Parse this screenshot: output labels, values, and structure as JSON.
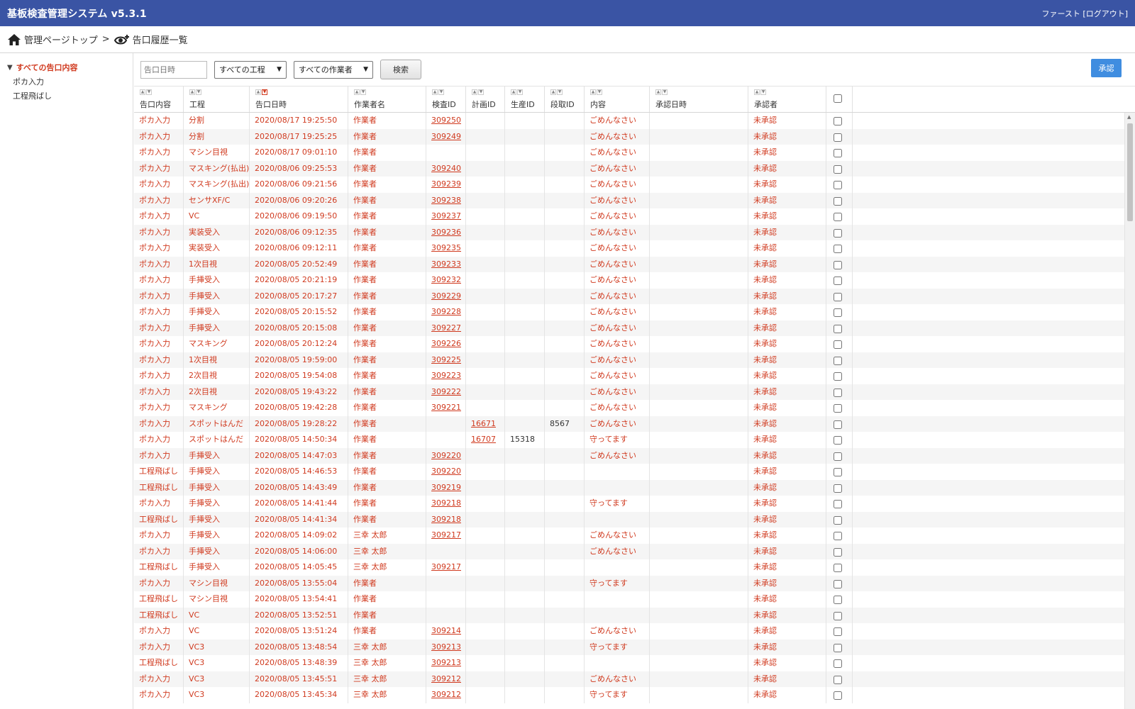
{
  "header": {
    "title": "基板検査管理システム v5.3.1",
    "user_name": "ファースト",
    "logout_label": "[ログアウト]"
  },
  "breadcrumb": {
    "home_label": "管理ページトップ",
    "separator": ">",
    "current_label": "告口履歴一覧"
  },
  "sidebar": {
    "root_label": "すべての告口内容",
    "items": [
      {
        "label": "ポカ入力"
      },
      {
        "label": "工程飛ばし"
      }
    ]
  },
  "toolbar": {
    "date_placeholder": "告口日時",
    "process_select": "すべての工程",
    "worker_select": "すべての作業者",
    "search_label": "検索",
    "approve_label": "承認"
  },
  "table": {
    "columns": [
      "告口内容",
      "工程",
      "告口日時",
      "作業者名",
      "検査ID",
      "計画ID",
      "生産ID",
      "段取ID",
      "内容",
      "承認日時",
      "承認者"
    ],
    "rows": [
      [
        "ポカ入力",
        "分割",
        "2020/08/17 19:25:50",
        "作業者",
        "309250",
        "",
        "",
        "",
        "ごめんなさい",
        "",
        "未承認"
      ],
      [
        "ポカ入力",
        "分割",
        "2020/08/17 19:25:25",
        "作業者",
        "309249",
        "",
        "",
        "",
        "ごめんなさい",
        "",
        "未承認"
      ],
      [
        "ポカ入力",
        "マシン目視",
        "2020/08/17 09:01:10",
        "作業者",
        "",
        "",
        "",
        "",
        "ごめんなさい",
        "",
        "未承認"
      ],
      [
        "ポカ入力",
        "マスキング(払出)",
        "2020/08/06 09:25:53",
        "作業者",
        "309240",
        "",
        "",
        "",
        "ごめんなさい",
        "",
        "未承認"
      ],
      [
        "ポカ入力",
        "マスキング(払出)",
        "2020/08/06 09:21:56",
        "作業者",
        "309239",
        "",
        "",
        "",
        "ごめんなさい",
        "",
        "未承認"
      ],
      [
        "ポカ入力",
        "センサXF/C",
        "2020/08/06 09:20:26",
        "作業者",
        "309238",
        "",
        "",
        "",
        "ごめんなさい",
        "",
        "未承認"
      ],
      [
        "ポカ入力",
        "VC",
        "2020/08/06 09:19:50",
        "作業者",
        "309237",
        "",
        "",
        "",
        "ごめんなさい",
        "",
        "未承認"
      ],
      [
        "ポカ入力",
        "実装受入",
        "2020/08/06 09:12:35",
        "作業者",
        "309236",
        "",
        "",
        "",
        "ごめんなさい",
        "",
        "未承認"
      ],
      [
        "ポカ入力",
        "実装受入",
        "2020/08/06 09:12:11",
        "作業者",
        "309235",
        "",
        "",
        "",
        "ごめんなさい",
        "",
        "未承認"
      ],
      [
        "ポカ入力",
        "1次目視",
        "2020/08/05 20:52:49",
        "作業者",
        "309233",
        "",
        "",
        "",
        "ごめんなさい",
        "",
        "未承認"
      ],
      [
        "ポカ入力",
        "手挿受入",
        "2020/08/05 20:21:19",
        "作業者",
        "309232",
        "",
        "",
        "",
        "ごめんなさい",
        "",
        "未承認"
      ],
      [
        "ポカ入力",
        "手挿受入",
        "2020/08/05 20:17:27",
        "作業者",
        "309229",
        "",
        "",
        "",
        "ごめんなさい",
        "",
        "未承認"
      ],
      [
        "ポカ入力",
        "手挿受入",
        "2020/08/05 20:15:52",
        "作業者",
        "309228",
        "",
        "",
        "",
        "ごめんなさい",
        "",
        "未承認"
      ],
      [
        "ポカ入力",
        "手挿受入",
        "2020/08/05 20:15:08",
        "作業者",
        "309227",
        "",
        "",
        "",
        "ごめんなさい",
        "",
        "未承認"
      ],
      [
        "ポカ入力",
        "マスキング",
        "2020/08/05 20:12:24",
        "作業者",
        "309226",
        "",
        "",
        "",
        "ごめんなさい",
        "",
        "未承認"
      ],
      [
        "ポカ入力",
        "1次目視",
        "2020/08/05 19:59:00",
        "作業者",
        "309225",
        "",
        "",
        "",
        "ごめんなさい",
        "",
        "未承認"
      ],
      [
        "ポカ入力",
        "2次目視",
        "2020/08/05 19:54:08",
        "作業者",
        "309223",
        "",
        "",
        "",
        "ごめんなさい",
        "",
        "未承認"
      ],
      [
        "ポカ入力",
        "2次目視",
        "2020/08/05 19:43:22",
        "作業者",
        "309222",
        "",
        "",
        "",
        "ごめんなさい",
        "",
        "未承認"
      ],
      [
        "ポカ入力",
        "マスキング",
        "2020/08/05 19:42:28",
        "作業者",
        "309221",
        "",
        "",
        "",
        "ごめんなさい",
        "",
        "未承認"
      ],
      [
        "ポカ入力",
        "スポットはんだ",
        "2020/08/05 19:28:22",
        "作業者",
        "",
        "16671",
        "",
        "8567",
        "ごめんなさい",
        "",
        "未承認"
      ],
      [
        "ポカ入力",
        "スポットはんだ",
        "2020/08/05 14:50:34",
        "作業者",
        "",
        "16707",
        "15318",
        "",
        "守ってます",
        "",
        "未承認"
      ],
      [
        "ポカ入力",
        "手挿受入",
        "2020/08/05 14:47:03",
        "作業者",
        "309220",
        "",
        "",
        "",
        "ごめんなさい",
        "",
        "未承認"
      ],
      [
        "工程飛ばし",
        "手挿受入",
        "2020/08/05 14:46:53",
        "作業者",
        "309220",
        "",
        "",
        "",
        "",
        "",
        "未承認"
      ],
      [
        "工程飛ばし",
        "手挿受入",
        "2020/08/05 14:43:49",
        "作業者",
        "309219",
        "",
        "",
        "",
        "",
        "",
        "未承認"
      ],
      [
        "ポカ入力",
        "手挿受入",
        "2020/08/05 14:41:44",
        "作業者",
        "309218",
        "",
        "",
        "",
        "守ってます",
        "",
        "未承認"
      ],
      [
        "工程飛ばし",
        "手挿受入",
        "2020/08/05 14:41:34",
        "作業者",
        "309218",
        "",
        "",
        "",
        "",
        "",
        "未承認"
      ],
      [
        "ポカ入力",
        "手挿受入",
        "2020/08/05 14:09:02",
        "三幸 太郎",
        "309217",
        "",
        "",
        "",
        "ごめんなさい",
        "",
        "未承認"
      ],
      [
        "ポカ入力",
        "手挿受入",
        "2020/08/05 14:06:00",
        "三幸 太郎",
        "",
        "",
        "",
        "",
        "ごめんなさい",
        "",
        "未承認"
      ],
      [
        "工程飛ばし",
        "手挿受入",
        "2020/08/05 14:05:45",
        "三幸 太郎",
        "309217",
        "",
        "",
        "",
        "",
        "",
        "未承認"
      ],
      [
        "ポカ入力",
        "マシン目視",
        "2020/08/05 13:55:04",
        "作業者",
        "",
        "",
        "",
        "",
        "守ってます",
        "",
        "未承認"
      ],
      [
        "工程飛ばし",
        "マシン目視",
        "2020/08/05 13:54:41",
        "作業者",
        "",
        "",
        "",
        "",
        "",
        "",
        "未承認"
      ],
      [
        "工程飛ばし",
        "VC",
        "2020/08/05 13:52:51",
        "作業者",
        "",
        "",
        "",
        "",
        "",
        "",
        "未承認"
      ],
      [
        "ポカ入力",
        "VC",
        "2020/08/05 13:51:24",
        "作業者",
        "309214",
        "",
        "",
        "",
        "ごめんなさい",
        "",
        "未承認"
      ],
      [
        "ポカ入力",
        "VC3",
        "2020/08/05 13:48:54",
        "三幸 太郎",
        "309213",
        "",
        "",
        "",
        "守ってます",
        "",
        "未承認"
      ],
      [
        "工程飛ばし",
        "VC3",
        "2020/08/05 13:48:39",
        "三幸 太郎",
        "309213",
        "",
        "",
        "",
        "",
        "",
        "未承認"
      ],
      [
        "ポカ入力",
        "VC3",
        "2020/08/05 13:45:51",
        "三幸 太郎",
        "309212",
        "",
        "",
        "",
        "ごめんなさい",
        "",
        "未承認"
      ],
      [
        "ポカ入力",
        "VC3",
        "2020/08/05 13:45:34",
        "三幸 太郎",
        "309212",
        "",
        "",
        "",
        "守ってます",
        "",
        "未承認"
      ]
    ]
  }
}
